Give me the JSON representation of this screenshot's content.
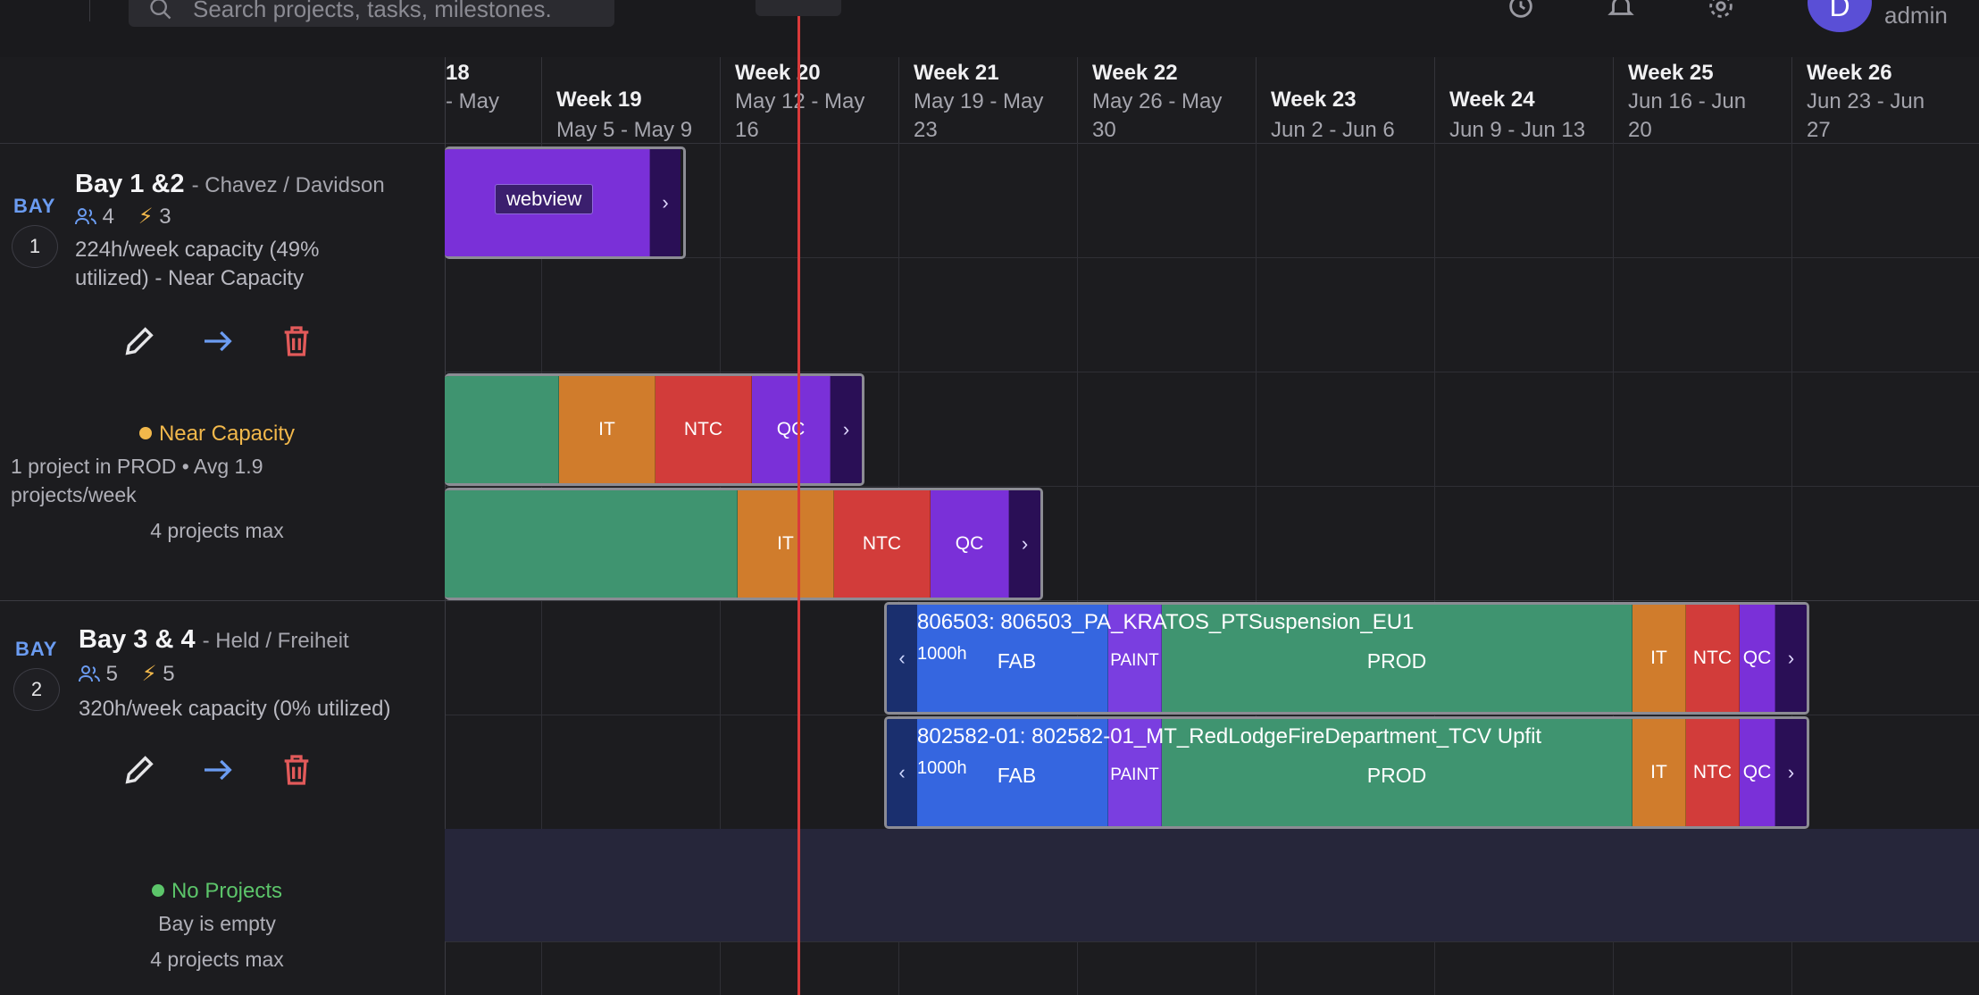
{
  "header": {
    "search_placeholder": "Search projects, tasks, milestones.",
    "user_initial": "D",
    "user_role": "admin"
  },
  "weeks": [
    {
      "name": "18",
      "dates": "- May"
    },
    {
      "name": "Week 19",
      "dates": "May 5 - May 9"
    },
    {
      "name": "Week 20",
      "dates": "May 12 - May 16"
    },
    {
      "name": "Week 21",
      "dates": "May 19 - May 23"
    },
    {
      "name": "Week 22",
      "dates": "May 26 - May 30"
    },
    {
      "name": "Week 23",
      "dates": "Jun 2 - Jun 6"
    },
    {
      "name": "Week 24",
      "dates": "Jun 9 - Jun 13"
    },
    {
      "name": "Week 25",
      "dates": "Jun 16 - Jun 20"
    },
    {
      "name": "Week 26",
      "dates": "Jun 23 - Jun 27"
    }
  ],
  "bays": [
    {
      "tag": "BAY",
      "number": "1",
      "name": "Bay 1 &2",
      "team": "- Chavez / Davidson",
      "people": "4",
      "power": "3",
      "capacity": "224h/week capacity (49% utilized) - Near Capacity",
      "status": "Near Capacity",
      "status_line1": "1 project in PROD • Avg 1.9 projects/week",
      "status_line2": "4 projects max",
      "status_color": "#f2b84b"
    },
    {
      "tag": "BAY",
      "number": "2",
      "name": "Bay 3 & 4",
      "team": "- Held / Freiheit",
      "people": "5",
      "power": "5",
      "capacity": "320h/week capacity (0% utilized)",
      "status": "No Projects",
      "status_line1": "Bay is empty",
      "status_line2": "4 projects max",
      "status_color": "#5cc56a"
    }
  ],
  "bars": {
    "webview_chip": "webview",
    "row2": [
      "IT",
      "NTC",
      "QC"
    ],
    "row3": [
      "IT",
      "NTC",
      "QC"
    ],
    "p1": {
      "title": "806503: 806503_PA_KRATOS_PTSuspension_EU1",
      "hours": "1000h",
      "phases": [
        "FAB",
        "PAINT",
        "PROD",
        "IT",
        "NTC",
        "QC"
      ]
    },
    "p2": {
      "title": "802582-01: 802582-01_MT_RedLodgeFireDepartment_TCV Upfit",
      "hours": "1000h",
      "phases": [
        "FAB",
        "PAINT",
        "PROD",
        "IT",
        "NTC",
        "QC"
      ]
    }
  },
  "colors": {
    "fab": "#3566e0",
    "paint": "#7a3ee0",
    "prod": "#3f9470",
    "it": "#d07c2c",
    "ntc": "#d23c3a",
    "qc": "#7a30d8",
    "today_line": "#d93a3a",
    "accent": "#6b9cf2"
  }
}
